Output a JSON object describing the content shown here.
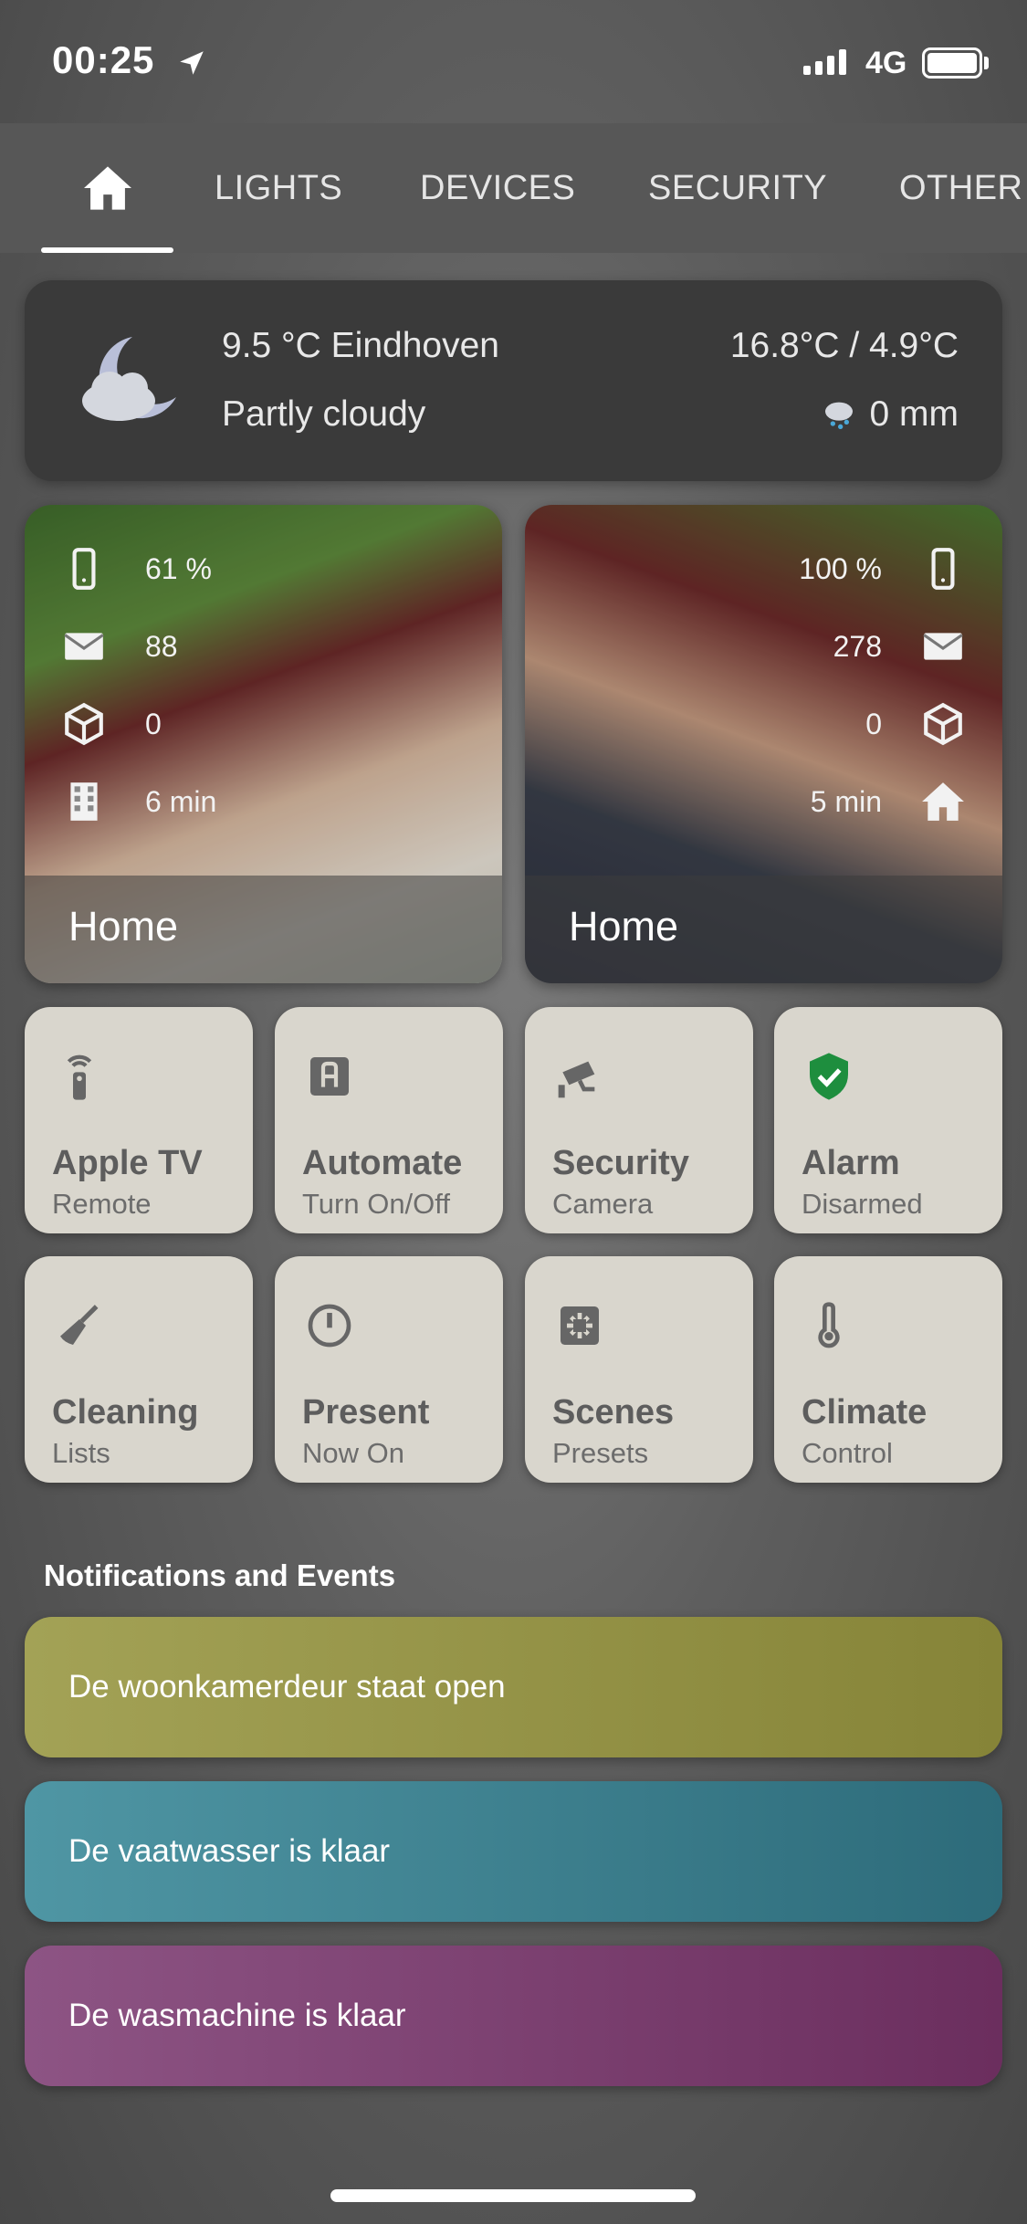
{
  "status_bar": {
    "time": "00:25",
    "network": "4G"
  },
  "tabs": [
    {
      "label": "LIGHTS"
    },
    {
      "label": "DEVICES"
    },
    {
      "label": "SECURITY"
    },
    {
      "label": "OTHER"
    }
  ],
  "weather": {
    "temp_location": "9.5 °C Eindhoven",
    "condition": "Partly cloudy",
    "range": "16.8°C / 4.9°C",
    "rain": "0 mm"
  },
  "persons": [
    {
      "battery": "61 %",
      "messages": "88",
      "packages": "0",
      "time": "6 min",
      "location": "Home"
    },
    {
      "battery": "100 %",
      "messages": "278",
      "packages": "0",
      "time": "5 min",
      "location": "Home"
    }
  ],
  "tiles": [
    {
      "title": "Apple TV",
      "subtitle": "Remote",
      "icon": "remote-icon"
    },
    {
      "title": "Automate",
      "subtitle": "Turn On/Off",
      "icon": "automation-icon"
    },
    {
      "title": "Security",
      "subtitle": "Camera",
      "icon": "cctv-icon"
    },
    {
      "title": "Alarm",
      "subtitle": "Disarmed",
      "icon": "shield-check-icon",
      "icon_color": "#1e8e3e"
    },
    {
      "title": "Cleaning",
      "subtitle": "Lists",
      "icon": "broom-icon"
    },
    {
      "title": "Present",
      "subtitle": "Now On",
      "icon": "power-icon"
    },
    {
      "title": "Scenes",
      "subtitle": "Presets",
      "icon": "scenes-icon"
    },
    {
      "title": "Climate",
      "subtitle": "Control",
      "icon": "thermometer-icon"
    }
  ],
  "notifications": {
    "title": "Notifications and Events",
    "items": [
      {
        "text": "De woonkamerdeur staat open",
        "color": "#9a9a4a"
      },
      {
        "text": "De vaatwasser is klaar",
        "color": "#3f8494"
      },
      {
        "text": "De wasmachine is klaar",
        "color": "#7c4272"
      }
    ]
  }
}
